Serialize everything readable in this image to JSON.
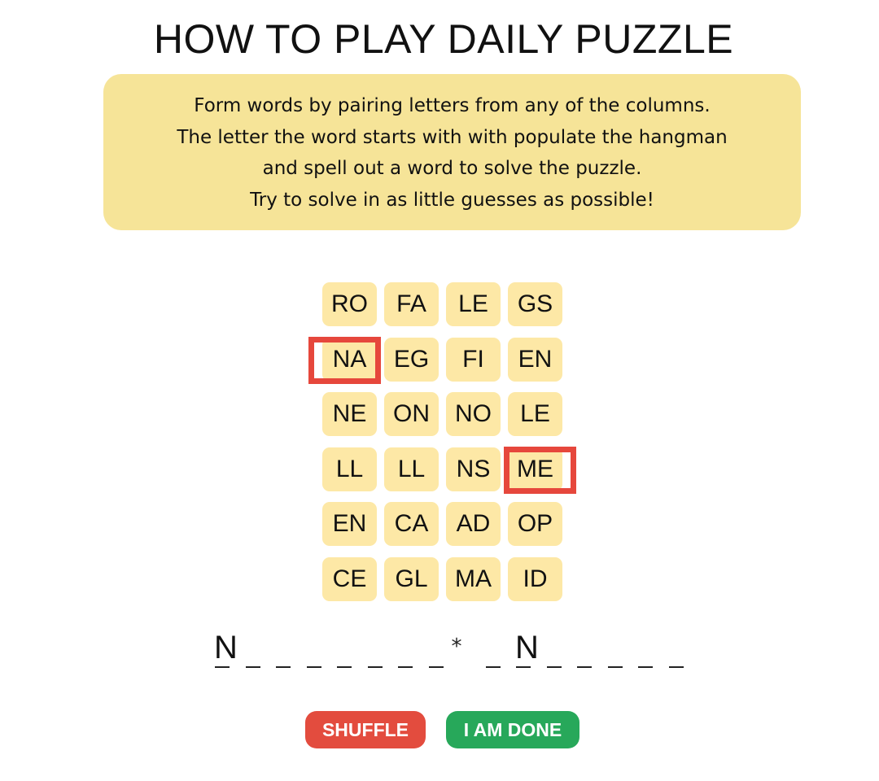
{
  "title": "HOW TO PLAY DAILY PUZZLE",
  "rules": [
    "Form words by pairing letters from any of the columns.",
    "The letter the word starts with with populate the hangman",
    "and spell out a word to solve the puzzle.",
    "Try to solve in as little guesses as possible!"
  ],
  "colors": {
    "rules_background": "#f6e498",
    "tile_background": "#fde8a6",
    "highlight": "#e6473c",
    "shuffle": "#e34c3e",
    "done": "#27a85a"
  },
  "grid": [
    [
      "RO",
      "FA",
      "LE",
      "GS"
    ],
    [
      "NA",
      "EG",
      "FI",
      "EN"
    ],
    [
      "NE",
      "ON",
      "NO",
      "LE"
    ],
    [
      "LL",
      "LL",
      "NS",
      "ME"
    ],
    [
      "EN",
      "CA",
      "AD",
      "OP"
    ],
    [
      "CE",
      "GL",
      "MA",
      "ID"
    ]
  ],
  "highlighted_tiles": [
    "NA",
    "ME"
  ],
  "hangman": {
    "word1": [
      "N",
      "",
      "",
      "",
      "",
      "",
      "",
      ""
    ],
    "separator": "*",
    "word2": [
      "",
      "N",
      "",
      "",
      "",
      "",
      ""
    ]
  },
  "buttons": {
    "shuffle": "SHUFFLE",
    "done": "I AM DONE"
  }
}
